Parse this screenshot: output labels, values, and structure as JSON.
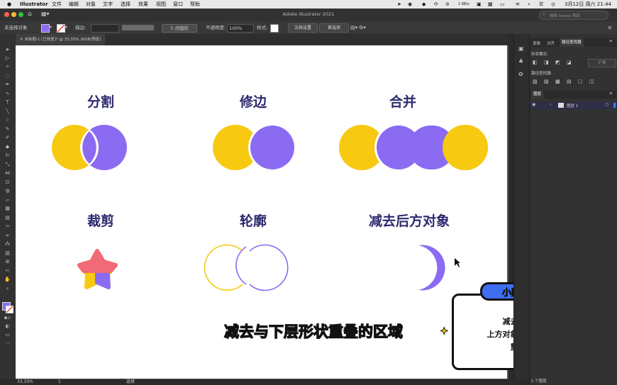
{
  "menubar": {
    "app": "Illustrator",
    "items": [
      "文件",
      "编辑",
      "对象",
      "文字",
      "选择",
      "效果",
      "视图",
      "窗口",
      "帮助"
    ],
    "status_speed": "1 KB/s",
    "clock": "3月12日 周六 21:44"
  },
  "appbar": {
    "title": "Adobe Illustrator 2021",
    "search_placeholder": "搜索 Adobe 帮助"
  },
  "control": {
    "no_selection": "未选择对象",
    "stroke_label": "描边:",
    "brush_label": "3 点圆形",
    "opacity_label": "不透明度:",
    "opacity_value": "100%",
    "style_label": "样式:",
    "doc_setup": "文档设置",
    "preferences": "首选项"
  },
  "document": {
    "tab_title": "未标题-1 [已恢复]* @ 33.33% (RGB/预览)"
  },
  "artboard": {
    "sections": [
      "分割",
      "修边",
      "合并",
      "裁剪",
      "轮廓",
      "减去后方对象"
    ],
    "subtitle": "减去与下层形状重叠的区域"
  },
  "tip": {
    "title": "小贴士",
    "line1": "减去后方对象：",
    "line2": "上方对象删除与下方对象",
    "line3": "重叠的区域"
  },
  "panels": {
    "tabs": [
      "变换",
      "对齐",
      "路径查找器"
    ],
    "shape_modes": "形状模式:",
    "expand": "扩展",
    "pathfinders": "路径查找器:",
    "layers_tab": "图层",
    "layer_name": "图层 1",
    "layer_count": "1 个图层"
  },
  "status": {
    "zoom": "33.33%",
    "page": "1",
    "tool": "选择"
  },
  "colors": {
    "yellow": "#f7c911",
    "purple": "#8b6bf2",
    "navy": "#2c2a6e",
    "coral": "#f06a78",
    "tip_blue": "#3f6ef0"
  }
}
